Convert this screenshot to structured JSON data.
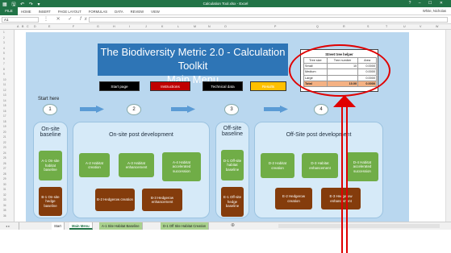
{
  "window": {
    "title": "Calculation Tool.xlsx - Excel",
    "user": "White, Nicholas",
    "controls": [
      "?",
      "–",
      "☐",
      "✕"
    ]
  },
  "ribbon": {
    "file_label": "FILE",
    "tabs": [
      "HOME",
      "INSERT",
      "PAGE LAYOUT",
      "FORMULAS",
      "DATA",
      "REVIEW",
      "VIEW"
    ]
  },
  "formula_bar": {
    "name_box": "A1",
    "fx": "fx",
    "value": ""
  },
  "columns": [
    "A",
    "B",
    "C",
    "D",
    "E",
    "F",
    "G",
    "H",
    "I",
    "J",
    "K",
    "L",
    "M",
    "N",
    "O",
    "P",
    "Q",
    "R",
    "S",
    "T",
    "U",
    "V",
    "W"
  ],
  "rows": [
    "1",
    "2",
    "3",
    "4",
    "5",
    "6",
    "7",
    "8",
    "9",
    "10",
    "11",
    "12",
    "13",
    "14",
    "15",
    "16",
    "17",
    "18",
    "19",
    "20",
    "21",
    "22",
    "23",
    "24",
    "25",
    "26",
    "27",
    "28",
    "29",
    "30",
    "31",
    "32",
    "33",
    "34",
    "35",
    "36"
  ],
  "sheet": {
    "main_title_line1": "The Biodiversity Metric 2.0 - Calculation Toolkit",
    "main_title_line2": "Main  Menu",
    "nav": {
      "start_page": "Start page",
      "instructions": "Instructions",
      "technical_data": "Technical data",
      "results": "Results"
    },
    "start_here": "Start here",
    "steps": [
      "1",
      "2",
      "3",
      "4"
    ],
    "panels": {
      "onsite_baseline": "On-site baseline",
      "onsite_post": "On-site post development",
      "offsite_baseline": "Off-site baseline",
      "offsite_post": "Off-Site post development"
    },
    "boxes": {
      "a1": "A-1 On-site habitat baseline",
      "b1": "B-1 On-site hedge baseline",
      "a2": "A-2 Habitat creation",
      "a3": "A-3 Habitat enhancement",
      "a4": "A-4 Habitat accelerated succession",
      "b2": "B-2 Hedgerow creation",
      "b3": "B-3 Hedgerow enhancement",
      "d1": "D-1 Off-site habitat baseline",
      "e1": "E-1 Off-site hedge baseline",
      "d2": "D-2 Habitat creation",
      "d3": "D-3 Habitat enhancement",
      "d4": "D-4 Habitat accelerated succession",
      "e2": "E-2 Hedgerow creation",
      "e3": "E-3 Hedgerow enhancement"
    },
    "street_tree_helper": {
      "title": "Street tree helper",
      "headers": [
        "Tree size",
        "Tree number",
        "Area"
      ],
      "rows": [
        [
          "Small",
          "10",
          "0.0000"
        ],
        [
          "Medium",
          "",
          "0.0000"
        ],
        [
          "Large",
          "",
          "0.0000"
        ]
      ],
      "total": [
        "Total",
        "10.00",
        "0.0000"
      ]
    }
  },
  "sheet_tabs": [
    "Start",
    "Main Menu",
    "A-1 Site Habitat Baseline",
    "D-1 Off Site Habitat Creation"
  ],
  "colors": {
    "excel_green": "#217346",
    "title_blue": "#2e75b6",
    "habitat_green": "#70ad47",
    "hedge_brown": "#843c0c",
    "highlight_red": "#e00000"
  }
}
